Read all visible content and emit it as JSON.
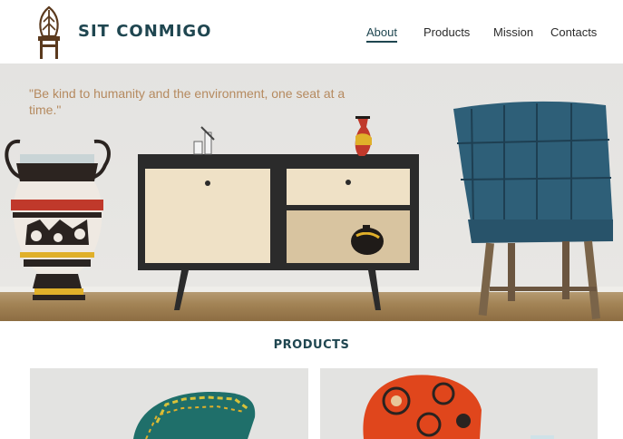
{
  "brand": {
    "name": "SIT CONMIGO"
  },
  "nav": {
    "items": [
      {
        "label": "About",
        "active": true
      },
      {
        "label": "Products",
        "active": false
      },
      {
        "label": "Mission",
        "active": false
      },
      {
        "label": "Contacts",
        "active": false
      }
    ]
  },
  "hero": {
    "quote": "\"Be kind to humanity and the environment, one seat at a time.\""
  },
  "products": {
    "title": "PRODUCTS"
  },
  "colors": {
    "brand": "#1f4650",
    "quote": "#b58a5f",
    "chair_blue": "#2e5f78",
    "chair_orange": "#e0461c",
    "chair_green": "#1f6f6a"
  },
  "icons": {
    "logo": "chair-logo-icon"
  }
}
